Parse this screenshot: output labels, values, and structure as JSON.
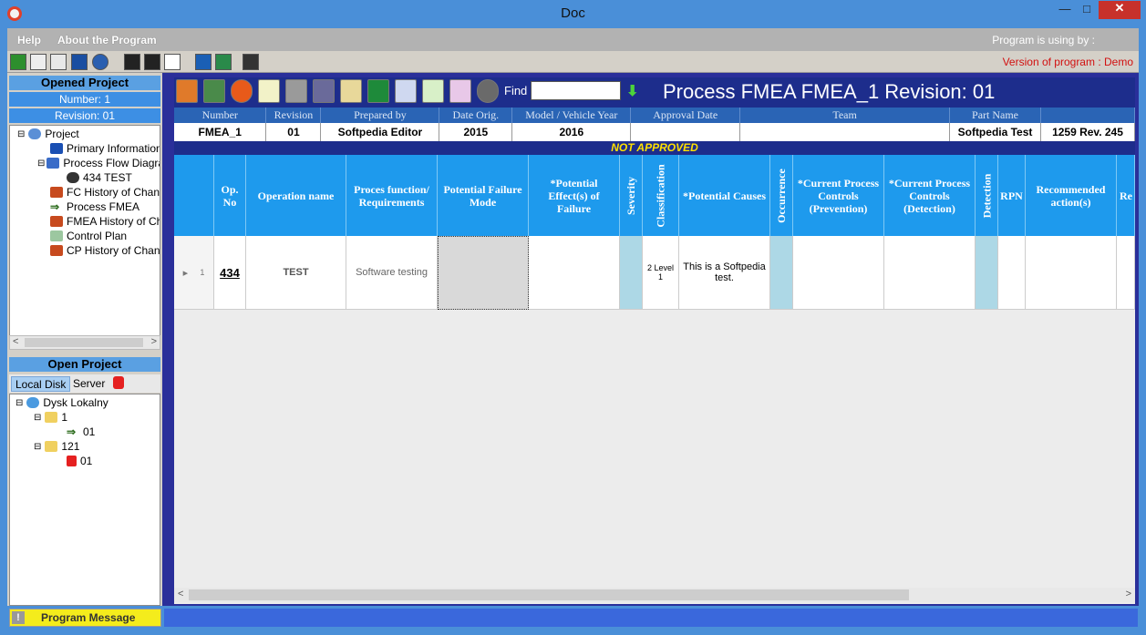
{
  "window": {
    "title": "Doc",
    "minimize": "—",
    "restore": "□",
    "close": "✕"
  },
  "menu": {
    "help": "Help",
    "about": "About the Program",
    "program_using": "Program is using by :"
  },
  "version": "Version of program : Demo",
  "opened_project": {
    "header": "Opened Project",
    "number": "Number: 1",
    "revision": "Revision: 01"
  },
  "project_tree": [
    {
      "label": "Project",
      "icon": "shield-icon"
    },
    {
      "label": "Primary Information",
      "icon": "info-icon"
    },
    {
      "label": "Process Flow Diagram",
      "icon": "flowchart-icon"
    },
    {
      "label": "434 TEST",
      "icon": "gear-icon"
    },
    {
      "label": "FC History of Change",
      "icon": "history-icon"
    },
    {
      "label": "Process FMEA",
      "icon": "arrow-right-icon"
    },
    {
      "label": "FMEA History of Chan",
      "icon": "history-icon"
    },
    {
      "label": "Control Plan",
      "icon": "table-icon"
    },
    {
      "label": "CP History of Change",
      "icon": "history-icon"
    }
  ],
  "open_project": {
    "header": "Open Project",
    "tab_local": "Local Disk",
    "tab_server": "Server"
  },
  "disk_tree": [
    {
      "label": "Dysk Lokalny",
      "icon": "globe-icon"
    },
    {
      "label": "1",
      "icon": "folder-icon"
    },
    {
      "label": "01",
      "icon": "arrow-right-icon"
    },
    {
      "label": "121",
      "icon": "folder-icon"
    },
    {
      "label": "01",
      "icon": "lock-icon"
    }
  ],
  "find": {
    "label": "Find",
    "value": ""
  },
  "fmea_title": "Process FMEA FMEA_1 Revision: 01",
  "info_headers": [
    "Number",
    "Revision",
    "Prepared by",
    "Date Orig.",
    "Model / Vehicle Year",
    "Approval Date",
    "Team",
    "Part Name",
    ""
  ],
  "info_values": [
    "FMEA_1",
    "01",
    "Softpedia Editor",
    "2015",
    "2016",
    "",
    "",
    "Softpedia Test",
    "1259 Rev. 245"
  ],
  "approval_status": "NOT APPROVED",
  "grid_headers": {
    "op_no": "Op. No",
    "operation_name": "Operation name",
    "process_function": "Proces function/ Requirements",
    "failure_mode": "Potential Failure Mode",
    "effects": "*Potential Effect(s) of Failure",
    "severity": "Severity",
    "classification": "Classification",
    "causes": "*Potential Causes",
    "occurrence": "Occurrence",
    "controls_prevention": "*Current Process Controls (Prevention)",
    "controls_detection": "*Current Process Controls (Detection)",
    "detection": "Detection",
    "rpn": "RPN",
    "recommended": "Recommended action(s)",
    "extra": "Re"
  },
  "grid_row": {
    "row_num": "1",
    "op_no": "434",
    "operation_name": "TEST",
    "process_function": "Software testing",
    "failure_mode": "",
    "effects": "",
    "severity": "",
    "classification": "2 Level 1",
    "causes": "This is a Softpedia test.",
    "occurrence": "",
    "controls_prevention": "",
    "controls_detection": "",
    "detection": "",
    "rpn": "",
    "recommended": ""
  },
  "status": {
    "message": "Program Message"
  },
  "colors": {
    "title_bar": "#4a8fd8",
    "header_blue": "#1e9aed",
    "navy": "#1d2d8c",
    "warning": "#f4ec1c",
    "version_red": "#d21010"
  }
}
